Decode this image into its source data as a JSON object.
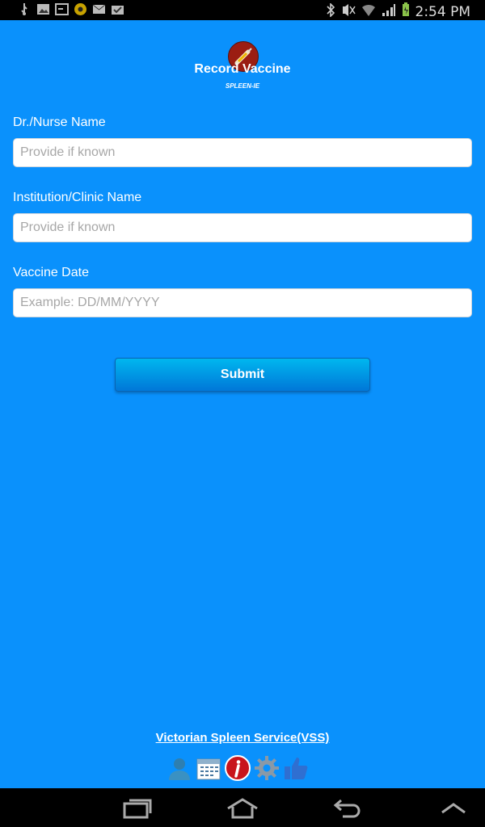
{
  "status_bar": {
    "time": "2:54 PM"
  },
  "header": {
    "title": "Record Vaccine",
    "subtitle": "SPLEEN-IE"
  },
  "form": {
    "fields": [
      {
        "label": "Dr./Nurse Name",
        "placeholder": "Provide if known",
        "value": ""
      },
      {
        "label": "Institution/Clinic Name",
        "placeholder": "Provide if known",
        "value": ""
      },
      {
        "label": "Vaccine Date",
        "placeholder": "Example: DD/MM/YYYY",
        "value": ""
      }
    ],
    "submit_label": "Submit"
  },
  "footer": {
    "link": "Victorian Spleen Service(VSS)",
    "icons": [
      "person-icon",
      "calendar-icon",
      "info-icon",
      "gear-icon",
      "thumbs-up-icon"
    ]
  },
  "colors": {
    "background": "#0a91fc",
    "button": "#0099e6",
    "info_red": "#c8141c"
  }
}
